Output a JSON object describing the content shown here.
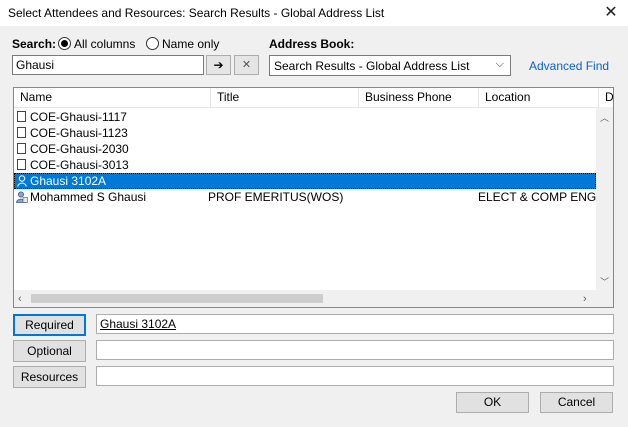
{
  "window": {
    "title": "Select Attendees and Resources: Search Results - Global Address List"
  },
  "search": {
    "label": "Search:",
    "option_all": "All columns",
    "option_name": "Name only",
    "query": "Ghausi",
    "go_glyph": "➔",
    "clear_glyph": "✕"
  },
  "address_book": {
    "label": "Address Book:",
    "selected": "Search Results - Global Address List",
    "advanced_find": "Advanced Find"
  },
  "table": {
    "columns": [
      "Name",
      "Title",
      "Business Phone",
      "Location",
      "D"
    ],
    "rows": [
      {
        "icon": "room-icon",
        "name": "COE-Ghausi-1117",
        "title": "",
        "phone": "",
        "location": ""
      },
      {
        "icon": "room-icon",
        "name": "COE-Ghausi-1123",
        "title": "",
        "phone": "",
        "location": ""
      },
      {
        "icon": "room-icon",
        "name": "COE-Ghausi-2030",
        "title": "",
        "phone": "",
        "location": ""
      },
      {
        "icon": "room-icon",
        "name": "COE-Ghausi-3013",
        "title": "",
        "phone": "",
        "location": ""
      },
      {
        "icon": "person-icon",
        "name": "Ghausi 3102A",
        "title": "",
        "phone": "",
        "location": "",
        "selected": true
      },
      {
        "icon": "contact-icon",
        "name": "Mohammed S Ghausi",
        "title": "PROF EMERITUS(WOS)",
        "phone": "",
        "location": "ELECT & COMP ENGR"
      }
    ]
  },
  "recipients": {
    "required_label": "Required",
    "required_value": "Ghausi 3102A",
    "optional_label": "Optional",
    "optional_value": "",
    "resources_label": "Resources",
    "resources_value": ""
  },
  "footer": {
    "ok": "OK",
    "cancel": "Cancel"
  }
}
